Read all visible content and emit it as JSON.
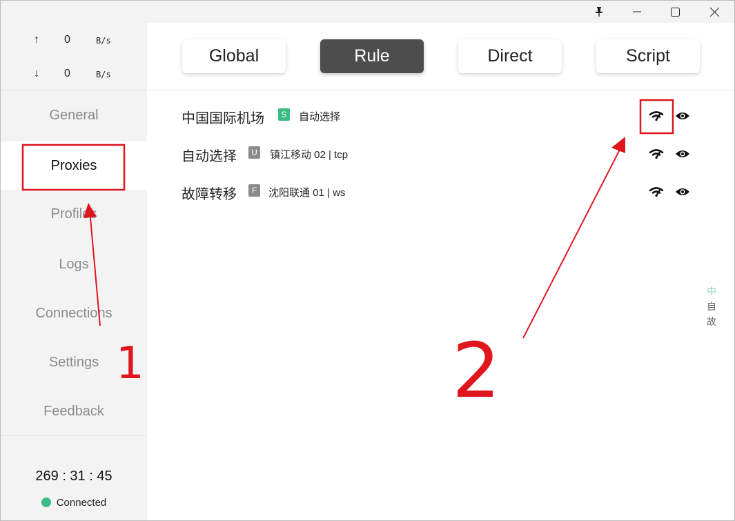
{
  "window": {
    "controls": {
      "pin_icon": "pin-icon",
      "minimize_icon": "minimize-icon",
      "maximize_icon": "maximize-icon",
      "close_icon": "close-icon"
    }
  },
  "traffic": {
    "upload": {
      "arrow": "↑",
      "value": "0",
      "unit": "B/s"
    },
    "download": {
      "arrow": "↓",
      "value": "0",
      "unit": "B/s"
    }
  },
  "sidebar": {
    "items": [
      {
        "label": "General"
      },
      {
        "label": "Proxies"
      },
      {
        "label": "Profiles"
      },
      {
        "label": "Logs"
      },
      {
        "label": "Connections"
      },
      {
        "label": "Settings"
      },
      {
        "label": "Feedback"
      }
    ],
    "active_index": 1
  },
  "footer": {
    "uptime": "269 : 31 : 45",
    "status_label": "Connected",
    "status_color": "#3dbb84"
  },
  "modes": {
    "items": [
      {
        "label": "Global"
      },
      {
        "label": "Rule"
      },
      {
        "label": "Direct"
      },
      {
        "label": "Script"
      }
    ],
    "active_index": 1
  },
  "groups": [
    {
      "name": "中国国际机场",
      "type_badge": "S",
      "badge_color": "#3dbb84",
      "current": "自动选择",
      "icons": [
        "speed-test-icon",
        "eye-icon"
      ]
    },
    {
      "name": "自动选择",
      "type_badge": "U",
      "badge_color": "#8a8a8a",
      "current": "镇江移动 02 | tcp",
      "icons": [
        "speed-test-icon",
        "eye-icon"
      ]
    },
    {
      "name": "故障转移",
      "type_badge": "F",
      "badge_color": "#8a8a8a",
      "current": "沈阳联通 01 | ws",
      "icons": [
        "speed-test-icon",
        "eye-icon"
      ]
    }
  ],
  "side_index": [
    {
      "char": "中",
      "color": "#8fd3b4"
    },
    {
      "char": "自",
      "color": "#666666"
    },
    {
      "char": "故",
      "color": "#666666"
    }
  ],
  "annotations": {
    "color": "#e0161f",
    "label_1": "1",
    "label_2": "2"
  }
}
